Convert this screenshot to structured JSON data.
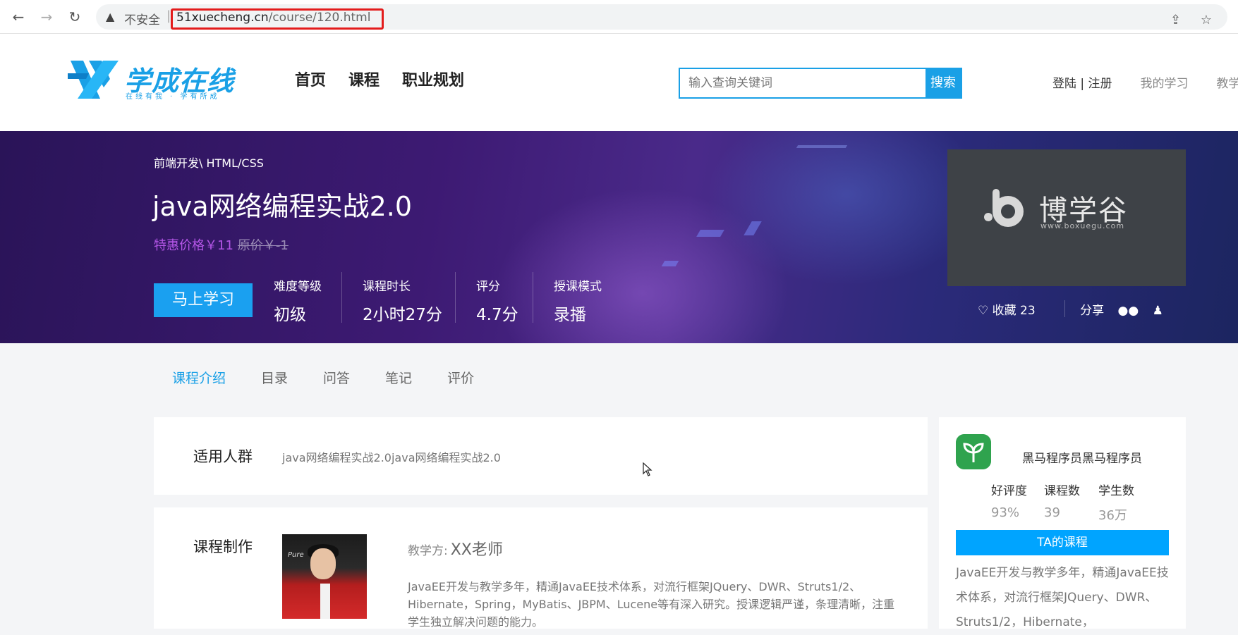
{
  "browser": {
    "insecure_label": "不安全",
    "url_domain": "51xuecheng.cn",
    "url_path": "/course/120.html"
  },
  "header": {
    "logo_text": "学成在线",
    "logo_tagline": "在线有我 · 学有所成",
    "nav": [
      "首页",
      "课程",
      "职业规划"
    ],
    "search_placeholder": "输入查询关键词",
    "search_button": "搜索",
    "login_register": "登陆 | 注册",
    "my_learning": "我的学习",
    "teach_partial": "教学"
  },
  "hero": {
    "breadcrumb": "前端开发\\ HTML/CSS",
    "title": "java网络编程实战2.0",
    "price": "特惠价格￥11",
    "original_price": "原价￥-1",
    "cta": "马上学习",
    "stats": [
      {
        "label": "难度等级",
        "value": "初级"
      },
      {
        "label": "课程时长",
        "value": "2小时27分"
      },
      {
        "label": "评分",
        "value": "4.7分"
      },
      {
        "label": "授课模式",
        "value": "录播"
      }
    ],
    "cover_brand": "博学谷",
    "cover_url": "www.boxuegu.com",
    "favorites": "收藏 23",
    "share": "分享"
  },
  "tabs": [
    "课程介绍",
    "目录",
    "问答",
    "笔记",
    "评价"
  ],
  "audience": {
    "heading": "适用人群",
    "text": "java网络编程实战2.0java网络编程实战2.0"
  },
  "making": {
    "heading": "课程制作",
    "photo_tag": "Pure",
    "teacher_label": "教学方:",
    "teacher_name": "XX老师",
    "description": "JavaEE开发与教学多年，精通JavaEE技术体系，对流行框架JQuery、DWR、Struts1/2、Hibernate，Spring，MyBatis、JBPM、Lucene等有深入研究。授课逻辑严谨，条理清晰，注重学生独立解决问题的能力。"
  },
  "organization": {
    "name": "黑马程序员黑马程序员",
    "stats": [
      {
        "label": "好评度",
        "value": "93%"
      },
      {
        "label": "课程数",
        "value": "39"
      },
      {
        "label": "学生数",
        "value": "36万"
      }
    ],
    "button": "TA的课程",
    "description": "JavaEE开发与教学多年，精通JavaEE技术体系，对流行框架JQuery、DWR、Struts1/2，Hibernate，"
  },
  "colors": {
    "accent": "#1aa0e6",
    "price": "#b556e8",
    "url_highlight": "#e31c1c"
  }
}
